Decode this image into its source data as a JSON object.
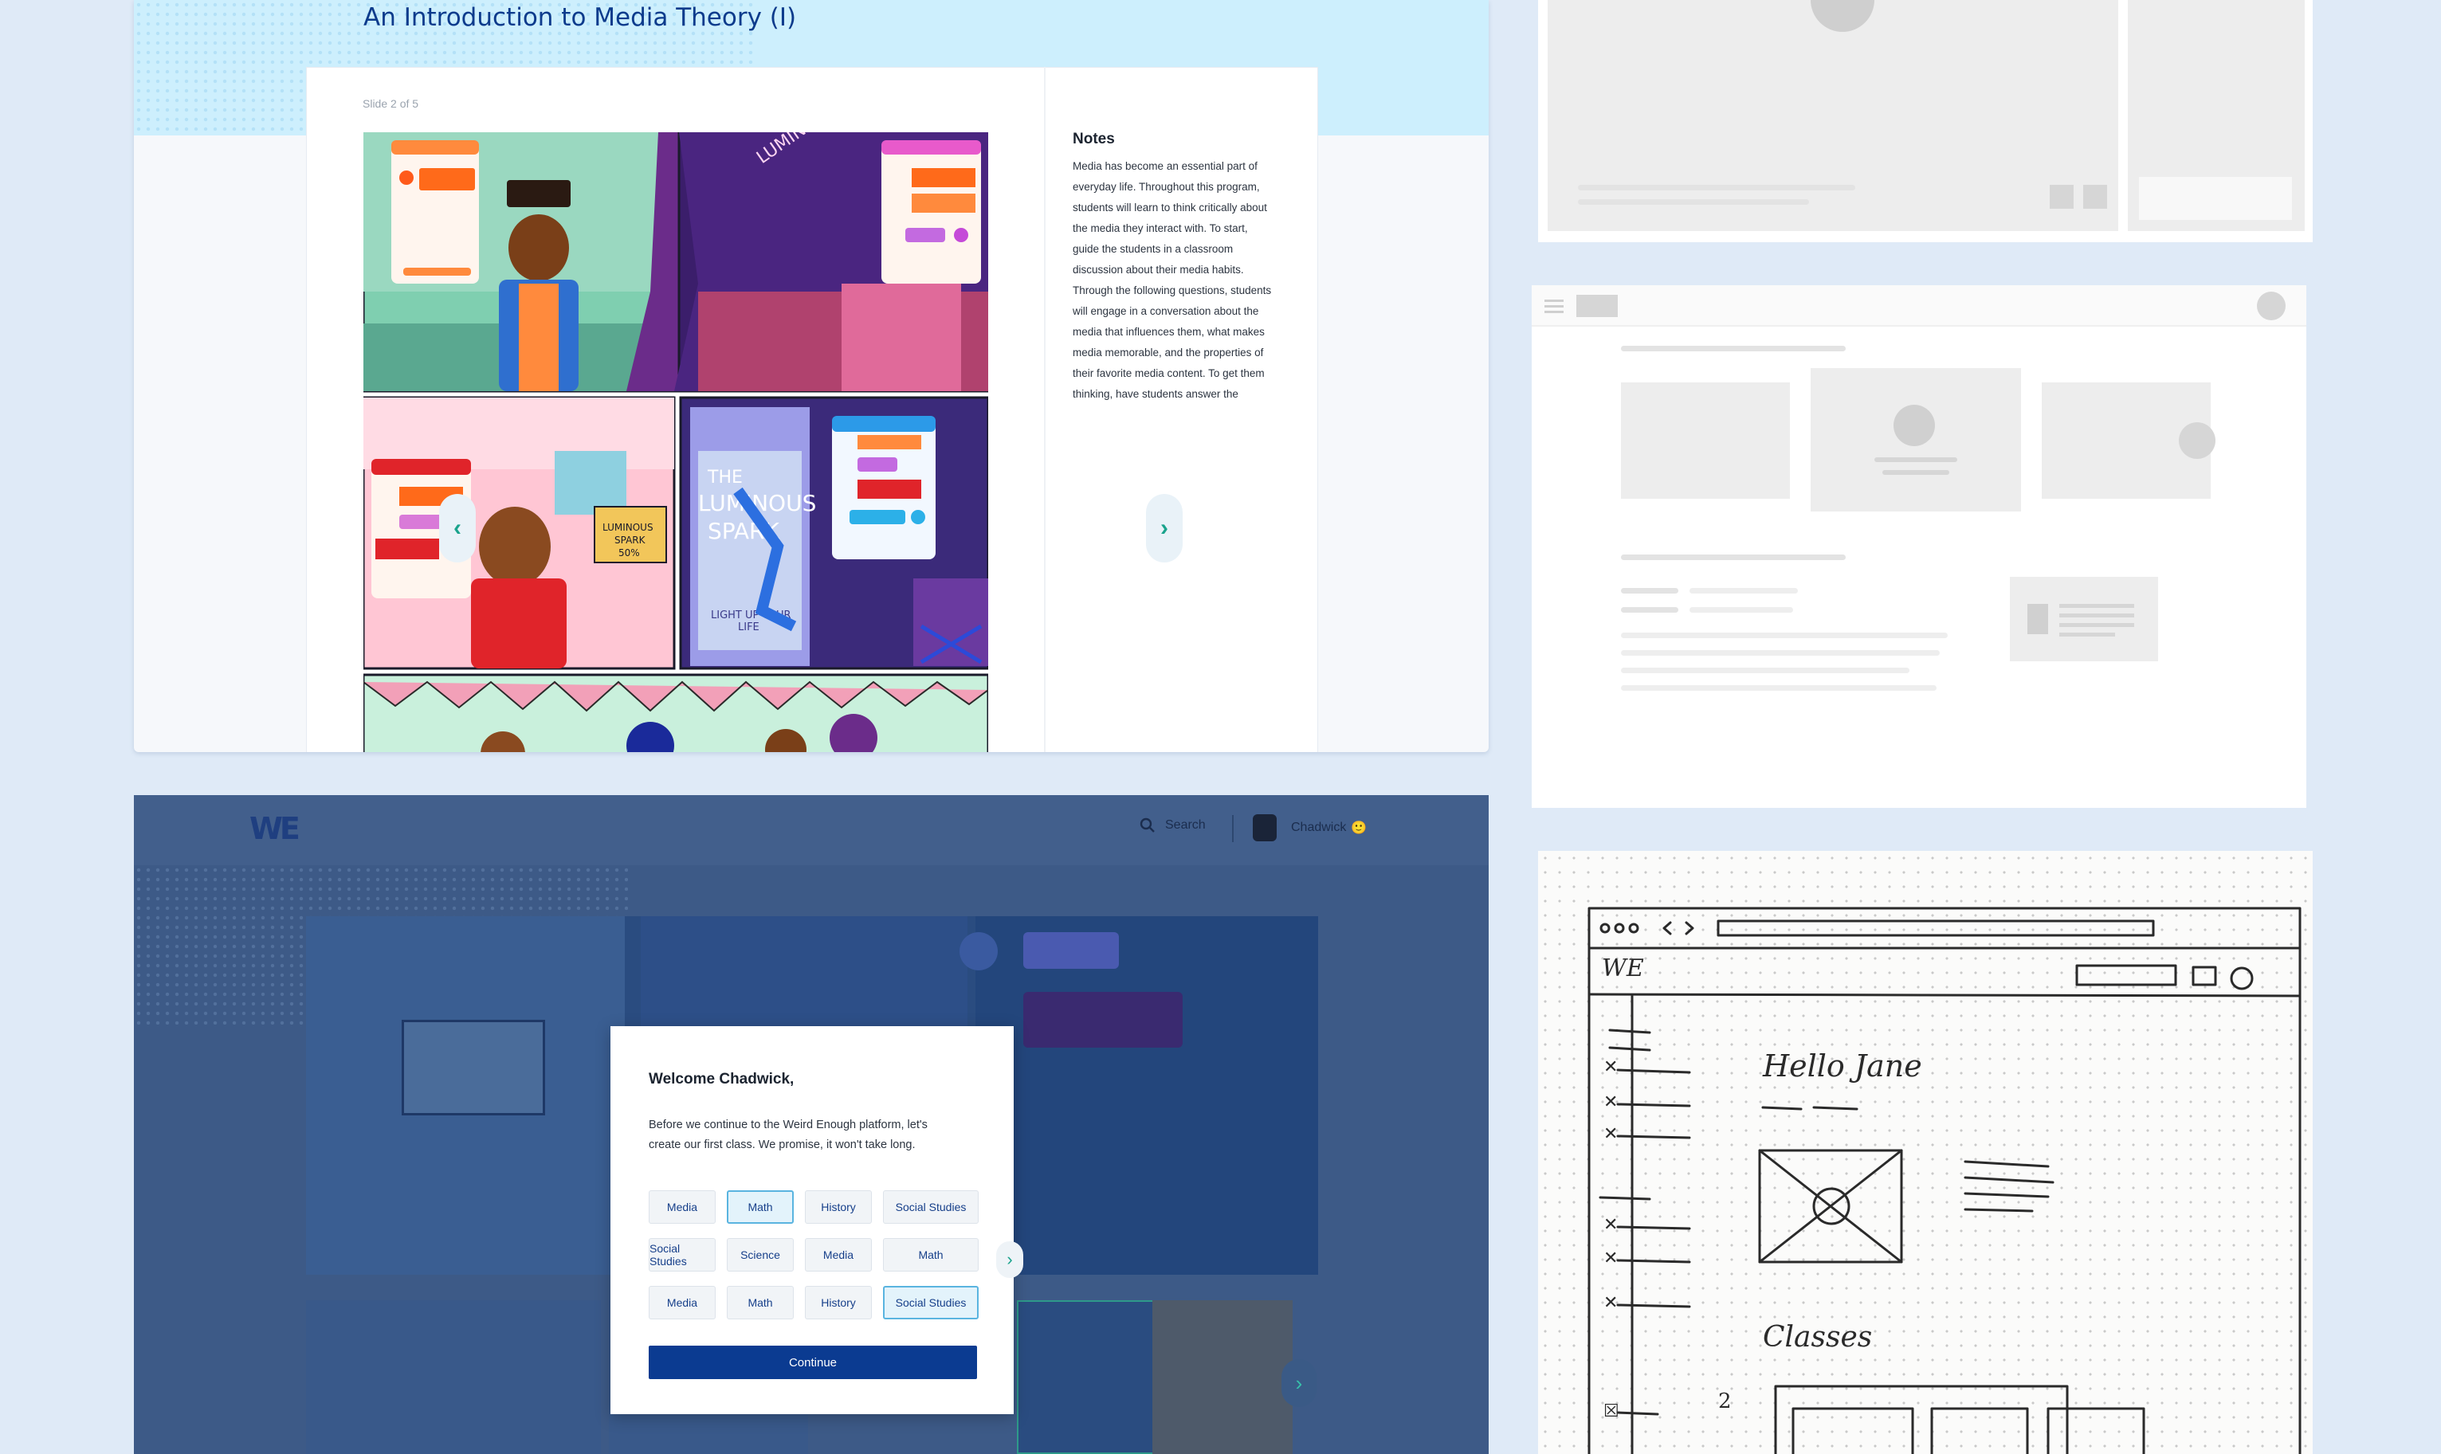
{
  "lesson": {
    "title": "An Introduction to Media Theory (I)",
    "slide_counter": "Slide 2 of 5",
    "notes_heading": "Notes",
    "notes_lines": [
      "Media has become an essential part of",
      "everyday life. Throughout this program,",
      "students will learn to think critically about",
      "the media they interact with. To start,",
      "guide the students in a classroom",
      "discussion about their media habits.",
      "Through the following questions, students",
      "will engage in a conversation about the",
      "media that influences them, what makes",
      "media memorable, and the properties of",
      "their favorite media content. To get them",
      "thinking, have students answer the"
    ],
    "prev_icon": "chevron-left-icon",
    "next_icon": "chevron-right-icon"
  },
  "app": {
    "logo_text": "WE",
    "search_label": "Search",
    "user_name": "Chadwick",
    "user_emoji": "🙂"
  },
  "modal": {
    "heading": "Welcome Chadwick,",
    "body_line1": "Before we continue to the Weird Enough platform, let's",
    "body_line2": "create our first class. We promise, it won't take long.",
    "rows": [
      [
        {
          "label": "Media",
          "selected": false
        },
        {
          "label": "Math",
          "selected": true
        },
        {
          "label": "History",
          "selected": false
        },
        {
          "label": "Social Studies",
          "selected": false
        }
      ],
      [
        {
          "label": "Social Studies",
          "selected": false
        },
        {
          "label": "Science",
          "selected": false
        },
        {
          "label": "Media",
          "selected": false
        },
        {
          "label": "Math",
          "selected": false
        }
      ],
      [
        {
          "label": "Media",
          "selected": false
        },
        {
          "label": "Math",
          "selected": false
        },
        {
          "label": "History",
          "selected": false
        },
        {
          "label": "Social Studies",
          "selected": true
        }
      ]
    ],
    "continue_label": "Continue"
  },
  "sketch": {
    "greeting": "Hello Jane",
    "classes": "Classes",
    "logo": "WE",
    "number": "2"
  },
  "colors": {
    "title": "#0d3b8c",
    "accent": "#1aa38c",
    "primary_button": "#0b3b91",
    "chip_selected_border": "#5ab4e0"
  }
}
